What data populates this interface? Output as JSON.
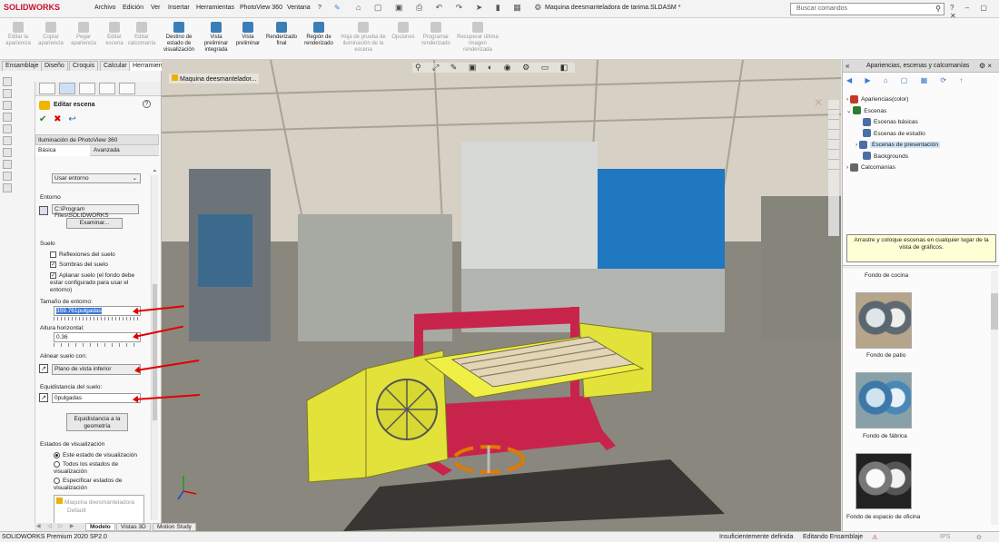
{
  "app": {
    "logo": "SOLIDWORKS",
    "document_title": "Maquina deesmanteladora de tarima.SLDASM *"
  },
  "menu": [
    "Archivo",
    "Edición",
    "Ver",
    "Insertar",
    "Herramientas",
    "PhotoView 360",
    "Ventana",
    "?"
  ],
  "search": {
    "placeholder": "Buscar comandos"
  },
  "ribbon": [
    {
      "label": "Editar la apariencia",
      "enabled": false
    },
    {
      "label": "Copiar apariencia",
      "enabled": false
    },
    {
      "label": "Pegar apariencia",
      "enabled": false
    },
    {
      "label": "Editar escena",
      "enabled": false
    },
    {
      "label": "Editar calcomanía",
      "enabled": false
    },
    {
      "label": "Destino de estado de visualización",
      "enabled": true
    },
    {
      "label": "Vista preliminar integrada",
      "enabled": true
    },
    {
      "label": "Vista preliminar",
      "enabled": true
    },
    {
      "label": "Renderizado final",
      "enabled": true
    },
    {
      "label": "Región de renderizado",
      "enabled": true
    },
    {
      "label": "Hoja de prueba de iluminación de la escena",
      "enabled": false
    },
    {
      "label": "Opciones",
      "enabled": false
    },
    {
      "label": "Programar renderizado",
      "enabled": false
    },
    {
      "label": "Recuperar última imagen renderizada",
      "enabled": false
    }
  ],
  "tabs": [
    "Ensamblaje",
    "Diseño",
    "Croquis",
    "Calcular",
    "Herramientas de renderizado"
  ],
  "property_manager": {
    "title": "Editar escena",
    "photoview_label": "Iluminación de PhotoView 360",
    "subtabs": [
      "Básica",
      "Avanzada"
    ],
    "background_value": "Usar entorno",
    "environment_header": "Entorno",
    "environment_path": "C:\\Program Files\\SOLIDWORKS",
    "browse_button": "Examinar...",
    "floor_header": "Suelo",
    "floor_reflections": "Reflexiones del suelo",
    "floor_shadows": "Sombras del suelo",
    "align_floor": "Aplanar suelo (el fondo debe estar configurado para usar el entorno)",
    "env_size_label": "Tamaño de entorno:",
    "env_size_value": "359.761pulgadas",
    "horizon_label": "Altura horizontal:",
    "horizon_value": "0.36",
    "align_floor_label": "Alinear suelo con:",
    "align_floor_value": "Plano de vista inferior",
    "floor_offset_label": "Equidistancia del suelo:",
    "floor_offset_value": "0pulgadas",
    "floor_offset_button": "Equidistancia a la geometría",
    "display_states_header": "Estados de visualización",
    "ds_options": [
      "Este estado de visualización",
      "Todos los estados de visualización",
      "Especificar estados de visualización"
    ],
    "ds_tree_item": "Maquina deesmanteladora",
    "ds_default": "Default"
  },
  "viewport": {
    "breadcrumb": "Maquina deesmantelador..."
  },
  "right_panel": {
    "title": "Apariencias, escenas y calcomanías",
    "tree": [
      {
        "label": "Apariencias(color)",
        "level": 0,
        "color": "#c0392b"
      },
      {
        "label": "Escenas",
        "level": 0,
        "color": "#2e7d32"
      },
      {
        "label": "Escenas básicas",
        "level": 1,
        "color": "#4a6fa5"
      },
      {
        "label": "Escenas de estudio",
        "level": 1,
        "color": "#4a6fa5"
      },
      {
        "label": "Escenas de presentación",
        "level": 1,
        "color": "#4a6fa5"
      },
      {
        "label": "Backgrounds",
        "level": 1,
        "color": "#4a6fa5"
      },
      {
        "label": "Calcomanías",
        "level": 0,
        "color": "#666666"
      }
    ],
    "hint": "Arrastre y coloque escenas en cualquier lugar de la vista de gráficos.",
    "thumbnails": [
      "Fondo de cocina",
      "Fondo de patio",
      "Fondo de fábrica",
      "Fondo de espacio de oficina"
    ]
  },
  "bottom_tabs": [
    "Modelo",
    "Vistas 3D",
    "Motion Study 1"
  ],
  "status": {
    "version": "SOLIDWORKS Premium 2020 SP2.0",
    "definition": "Insuficientemente definida",
    "mode": "Editando Ensamblaje",
    "units": "IPS"
  },
  "colors": {
    "accent": "#3a78d6",
    "machine_yellow": "#e2e23a",
    "machine_red": "#c8244b"
  }
}
